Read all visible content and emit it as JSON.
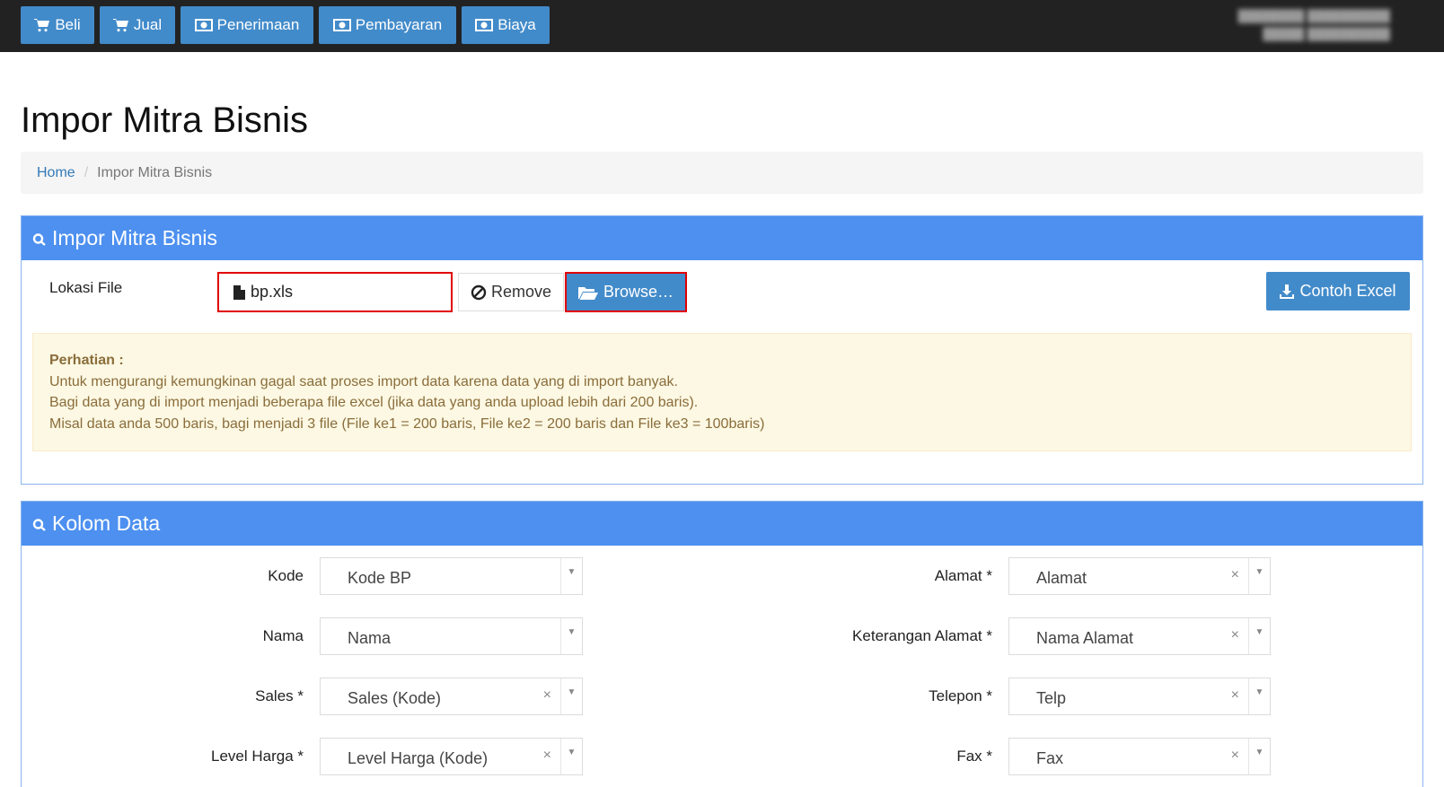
{
  "nav": {
    "items": [
      {
        "label": "Beli",
        "icon": "cart-icon"
      },
      {
        "label": "Jual",
        "icon": "cart-icon"
      },
      {
        "label": "Penerimaan",
        "icon": "money-icon"
      },
      {
        "label": "Pembayaran",
        "icon": "money-icon"
      },
      {
        "label": "Biaya",
        "icon": "money-icon"
      }
    ],
    "user_line1": "████████ ██████████",
    "user_line2": "█████ ██████████"
  },
  "page": {
    "title": "Impor Mitra Bisnis"
  },
  "breadcrumb": {
    "home": "Home",
    "separator": "/",
    "current": "Impor Mitra Bisnis"
  },
  "import_panel": {
    "title": "Impor Mitra Bisnis",
    "file_label": "Lokasi File",
    "file_name": "bp.xls",
    "remove_label": "Remove",
    "browse_label": "Browse…",
    "sample_label": "Contoh Excel",
    "notice": {
      "title": "Perhatian :",
      "line1": "Untuk mengurangi kemungkinan gagal saat proses import data karena data yang di import banyak.",
      "line2": "Bagi data yang di import menjadi beberapa file excel (jika data yang anda upload lebih dari 200 baris).",
      "line3": "Misal data anda 500 baris, bagi menjadi 3 file (File ke1 = 200 baris, File ke2 = 200 baris dan File ke3 = 100baris)"
    }
  },
  "columns_panel": {
    "title": "Kolom Data",
    "left": [
      {
        "label": "Kode",
        "value": "Kode BP"
      },
      {
        "label": "Nama",
        "value": "Nama"
      },
      {
        "label": "Sales *",
        "value": "Sales (Kode)"
      },
      {
        "label": "Level Harga *",
        "value": "Level Harga (Kode)"
      }
    ],
    "right": [
      {
        "label": "Alamat *",
        "value": "Alamat"
      },
      {
        "label": "Keterangan Alamat *",
        "value": "Nama Alamat"
      },
      {
        "label": "Telepon *",
        "value": "Telp"
      },
      {
        "label": "Fax *",
        "value": "Fax"
      }
    ],
    "clear_glyph": "×",
    "arrow_glyph": "▼"
  },
  "colors": {
    "primary": "#428bca",
    "panel_header": "#4d90f0",
    "highlight": "#e00000",
    "navbar": "#222222"
  }
}
